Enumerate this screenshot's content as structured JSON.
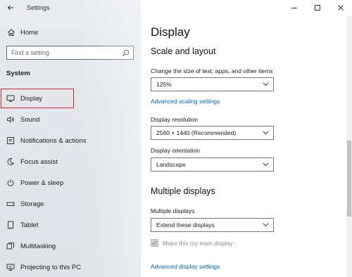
{
  "window": {
    "app_title": "Settings",
    "minimize": "—",
    "maximize": "☐",
    "close": "✕"
  },
  "sidebar": {
    "home_label": "Home",
    "search": {
      "placeholder": "Find a setting",
      "value": ""
    },
    "section_label": "System",
    "items": [
      {
        "label": "Display",
        "icon": "monitor-icon",
        "selected": true
      },
      {
        "label": "Sound",
        "icon": "speaker-icon",
        "selected": false
      },
      {
        "label": "Notifications & actions",
        "icon": "notification-icon",
        "selected": false
      },
      {
        "label": "Focus assist",
        "icon": "moon-icon",
        "selected": false
      },
      {
        "label": "Power & sleep",
        "icon": "power-icon",
        "selected": false
      },
      {
        "label": "Storage",
        "icon": "drive-icon",
        "selected": false
      },
      {
        "label": "Tablet",
        "icon": "tablet-icon",
        "selected": false
      },
      {
        "label": "Multitasking",
        "icon": "multitasking-icon",
        "selected": false
      },
      {
        "label": "Projecting to this PC",
        "icon": "projector-icon",
        "selected": false
      }
    ]
  },
  "main": {
    "title": "Display",
    "scale_layout": {
      "heading": "Scale and layout",
      "text_size_label": "Change the size of text, apps, and other items",
      "text_size_value": "125%",
      "advanced_scaling_link": "Advanced scaling settings",
      "resolution_label": "Display resolution",
      "resolution_value": "2560 × 1440 (Recommended)",
      "orientation_label": "Display orientation",
      "orientation_value": "Landscape"
    },
    "multiple_displays": {
      "heading": "Multiple displays",
      "label": "Multiple displays",
      "value": "Extend these displays",
      "main_display_checkbox": "Make this my main display",
      "main_display_checked": true,
      "advanced_display_link": "Advanced display settings"
    }
  },
  "colors": {
    "accent_link": "#0063b1",
    "selection_outline": "#e0222a"
  }
}
